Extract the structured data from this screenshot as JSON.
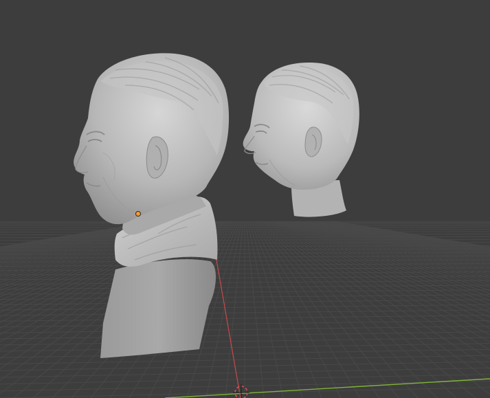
{
  "viewport": {
    "kind": "3d-viewport",
    "background_color": "#3d3d3d",
    "grid_line_color": "#4a4a4a",
    "x_axis_color": "#7fb33a",
    "y_axis_color": "#c94a4a",
    "mesh_color": "#b5b5b5",
    "origin_point_color": "#ff9a2a",
    "cursor_color": "#e05050",
    "objects": [
      {
        "name": "bust-with-shirt",
        "type": "mesh"
      },
      {
        "name": "head-bust",
        "type": "mesh"
      }
    ],
    "icons": {
      "origin": "origin-point-icon",
      "cursor": "3d-cursor-icon"
    }
  }
}
